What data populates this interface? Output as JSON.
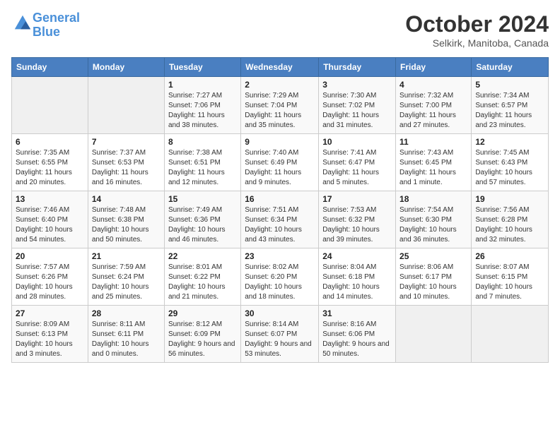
{
  "header": {
    "logo_line1": "General",
    "logo_line2": "Blue",
    "month_title": "October 2024",
    "location": "Selkirk, Manitoba, Canada"
  },
  "weekdays": [
    "Sunday",
    "Monday",
    "Tuesday",
    "Wednesday",
    "Thursday",
    "Friday",
    "Saturday"
  ],
  "weeks": [
    [
      {
        "day": "",
        "info": ""
      },
      {
        "day": "",
        "info": ""
      },
      {
        "day": "1",
        "info": "Sunrise: 7:27 AM\nSunset: 7:06 PM\nDaylight: 11 hours and 38 minutes."
      },
      {
        "day": "2",
        "info": "Sunrise: 7:29 AM\nSunset: 7:04 PM\nDaylight: 11 hours and 35 minutes."
      },
      {
        "day": "3",
        "info": "Sunrise: 7:30 AM\nSunset: 7:02 PM\nDaylight: 11 hours and 31 minutes."
      },
      {
        "day": "4",
        "info": "Sunrise: 7:32 AM\nSunset: 7:00 PM\nDaylight: 11 hours and 27 minutes."
      },
      {
        "day": "5",
        "info": "Sunrise: 7:34 AM\nSunset: 6:57 PM\nDaylight: 11 hours and 23 minutes."
      }
    ],
    [
      {
        "day": "6",
        "info": "Sunrise: 7:35 AM\nSunset: 6:55 PM\nDaylight: 11 hours and 20 minutes."
      },
      {
        "day": "7",
        "info": "Sunrise: 7:37 AM\nSunset: 6:53 PM\nDaylight: 11 hours and 16 minutes."
      },
      {
        "day": "8",
        "info": "Sunrise: 7:38 AM\nSunset: 6:51 PM\nDaylight: 11 hours and 12 minutes."
      },
      {
        "day": "9",
        "info": "Sunrise: 7:40 AM\nSunset: 6:49 PM\nDaylight: 11 hours and 9 minutes."
      },
      {
        "day": "10",
        "info": "Sunrise: 7:41 AM\nSunset: 6:47 PM\nDaylight: 11 hours and 5 minutes."
      },
      {
        "day": "11",
        "info": "Sunrise: 7:43 AM\nSunset: 6:45 PM\nDaylight: 11 hours and 1 minute."
      },
      {
        "day": "12",
        "info": "Sunrise: 7:45 AM\nSunset: 6:43 PM\nDaylight: 10 hours and 57 minutes."
      }
    ],
    [
      {
        "day": "13",
        "info": "Sunrise: 7:46 AM\nSunset: 6:40 PM\nDaylight: 10 hours and 54 minutes."
      },
      {
        "day": "14",
        "info": "Sunrise: 7:48 AM\nSunset: 6:38 PM\nDaylight: 10 hours and 50 minutes."
      },
      {
        "day": "15",
        "info": "Sunrise: 7:49 AM\nSunset: 6:36 PM\nDaylight: 10 hours and 46 minutes."
      },
      {
        "day": "16",
        "info": "Sunrise: 7:51 AM\nSunset: 6:34 PM\nDaylight: 10 hours and 43 minutes."
      },
      {
        "day": "17",
        "info": "Sunrise: 7:53 AM\nSunset: 6:32 PM\nDaylight: 10 hours and 39 minutes."
      },
      {
        "day": "18",
        "info": "Sunrise: 7:54 AM\nSunset: 6:30 PM\nDaylight: 10 hours and 36 minutes."
      },
      {
        "day": "19",
        "info": "Sunrise: 7:56 AM\nSunset: 6:28 PM\nDaylight: 10 hours and 32 minutes."
      }
    ],
    [
      {
        "day": "20",
        "info": "Sunrise: 7:57 AM\nSunset: 6:26 PM\nDaylight: 10 hours and 28 minutes."
      },
      {
        "day": "21",
        "info": "Sunrise: 7:59 AM\nSunset: 6:24 PM\nDaylight: 10 hours and 25 minutes."
      },
      {
        "day": "22",
        "info": "Sunrise: 8:01 AM\nSunset: 6:22 PM\nDaylight: 10 hours and 21 minutes."
      },
      {
        "day": "23",
        "info": "Sunrise: 8:02 AM\nSunset: 6:20 PM\nDaylight: 10 hours and 18 minutes."
      },
      {
        "day": "24",
        "info": "Sunrise: 8:04 AM\nSunset: 6:18 PM\nDaylight: 10 hours and 14 minutes."
      },
      {
        "day": "25",
        "info": "Sunrise: 8:06 AM\nSunset: 6:17 PM\nDaylight: 10 hours and 10 minutes."
      },
      {
        "day": "26",
        "info": "Sunrise: 8:07 AM\nSunset: 6:15 PM\nDaylight: 10 hours and 7 minutes."
      }
    ],
    [
      {
        "day": "27",
        "info": "Sunrise: 8:09 AM\nSunset: 6:13 PM\nDaylight: 10 hours and 3 minutes."
      },
      {
        "day": "28",
        "info": "Sunrise: 8:11 AM\nSunset: 6:11 PM\nDaylight: 10 hours and 0 minutes."
      },
      {
        "day": "29",
        "info": "Sunrise: 8:12 AM\nSunset: 6:09 PM\nDaylight: 9 hours and 56 minutes."
      },
      {
        "day": "30",
        "info": "Sunrise: 8:14 AM\nSunset: 6:07 PM\nDaylight: 9 hours and 53 minutes."
      },
      {
        "day": "31",
        "info": "Sunrise: 8:16 AM\nSunset: 6:06 PM\nDaylight: 9 hours and 50 minutes."
      },
      {
        "day": "",
        "info": ""
      },
      {
        "day": "",
        "info": ""
      }
    ]
  ]
}
